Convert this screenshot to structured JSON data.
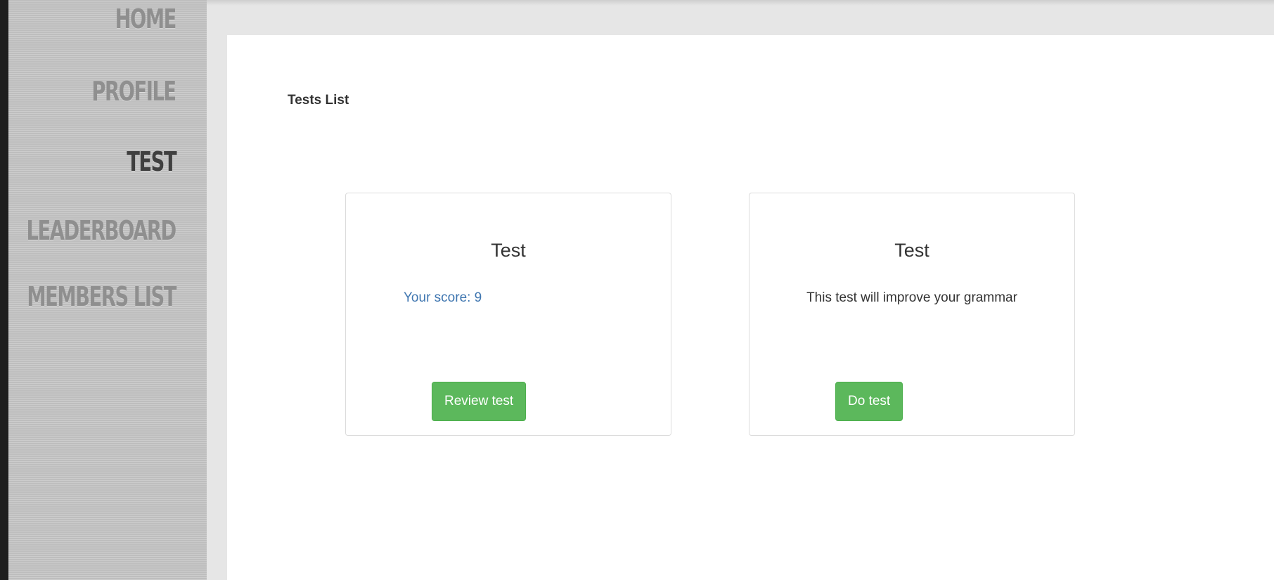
{
  "sidebar": {
    "items": [
      {
        "label": "HOME",
        "active": false
      },
      {
        "label": "PROFILE",
        "active": false
      },
      {
        "label": "TEST",
        "active": true
      },
      {
        "label": "LEADERBOARD",
        "active": false
      },
      {
        "label": "MEMBERS LIST",
        "active": false
      }
    ]
  },
  "main": {
    "title": "Tests List",
    "tests": [
      {
        "title": "Test",
        "score_text": "Your score: 9",
        "button_label": "Review test"
      },
      {
        "title": "Test",
        "description": "This test will improve your grammar",
        "button_label": "Do test"
      }
    ]
  },
  "colors": {
    "accent_green": "#5cb85c",
    "link_blue": "#3f76b0",
    "nav_active": "#3f3f3f",
    "nav_inactive": "#8f8f8f"
  }
}
